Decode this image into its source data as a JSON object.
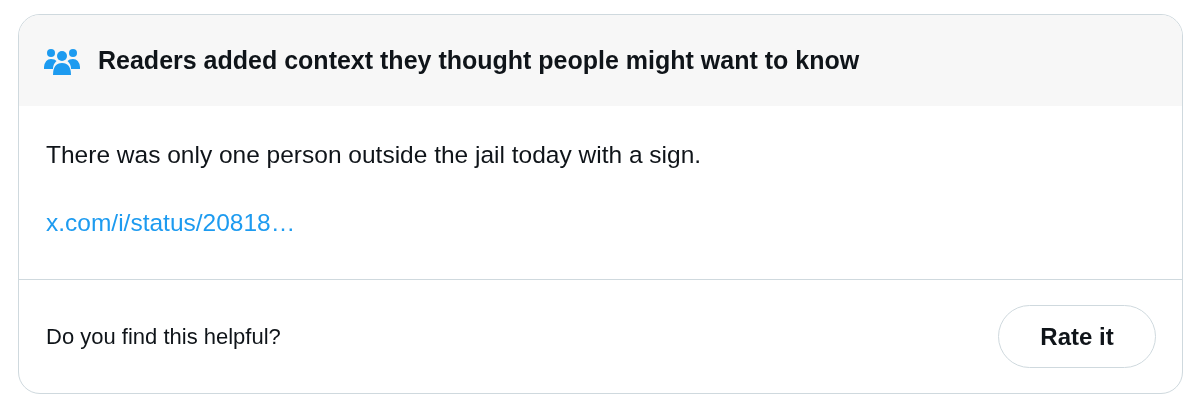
{
  "note": {
    "header": "Readers added context they thought people might want to know",
    "body": "There was only one person outside the jail today with a sign.",
    "link": "x.com/i/status/20818…"
  },
  "footer": {
    "question": "Do you find this helpful?",
    "button": "Rate it"
  }
}
